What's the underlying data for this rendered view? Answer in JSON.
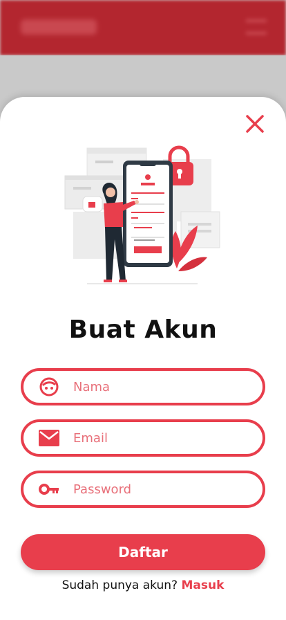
{
  "colors": {
    "accent": "#e83e4c",
    "header_bg": "#b3262f"
  },
  "modal": {
    "title": "Buat Akun",
    "close_icon": "close-icon",
    "illustration": "signup-phone-illustration"
  },
  "form": {
    "name": {
      "placeholder": "Nama",
      "value": "",
      "icon": "face-icon"
    },
    "email": {
      "placeholder": "Email",
      "value": "",
      "icon": "mail-icon"
    },
    "password": {
      "placeholder": "Password",
      "value": "",
      "icon": "key-icon"
    },
    "submit_label": "Daftar"
  },
  "footer": {
    "prompt": "Sudah punya akun?",
    "login_label": "Masuk"
  }
}
